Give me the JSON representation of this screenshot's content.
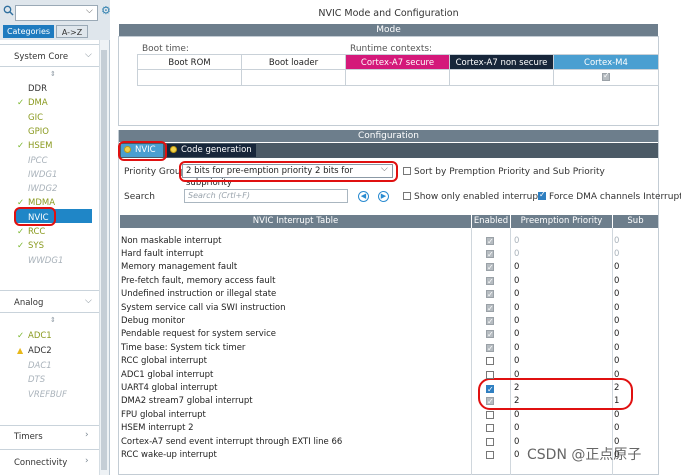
{
  "left_panel": {
    "categories_tab": "Categories",
    "az_tab": "A->Z",
    "system_core": "System Core",
    "system_core_items": [
      {
        "label": "DDR",
        "check": false,
        "style": "n"
      },
      {
        "label": "DMA",
        "check": true,
        "style": "g"
      },
      {
        "label": "GIC",
        "check": false,
        "style": "g"
      },
      {
        "label": "GPIO",
        "check": false,
        "style": "g"
      },
      {
        "label": "HSEM",
        "check": true,
        "style": "g"
      },
      {
        "label": "IPCC",
        "check": false,
        "style": "d"
      },
      {
        "label": "IWDG1",
        "check": false,
        "style": "d"
      },
      {
        "label": "IWDG2",
        "check": false,
        "style": "d"
      },
      {
        "label": "MDMA",
        "check": true,
        "style": "g"
      },
      {
        "label": "NVIC",
        "check": false,
        "style": "sel"
      },
      {
        "label": "RCC",
        "check": true,
        "style": "g"
      },
      {
        "label": "SYS",
        "check": true,
        "style": "g"
      },
      {
        "label": "WWDG1",
        "check": false,
        "style": "d"
      }
    ],
    "analog": "Analog",
    "analog_items": [
      {
        "label": "ADC1",
        "mark": "check",
        "style": "g"
      },
      {
        "label": "ADC2",
        "mark": "warn",
        "style": "n"
      },
      {
        "label": "DAC1",
        "mark": "",
        "style": "d"
      },
      {
        "label": "DTS",
        "mark": "",
        "style": "d"
      },
      {
        "label": "VREFBUF",
        "mark": "",
        "style": "d"
      }
    ],
    "timers": "Timers",
    "connectivity": "Connectivity"
  },
  "title": "NVIC Mode and Configuration",
  "mode": {
    "header": "Mode",
    "boot_time": "Boot time:",
    "runtime_contexts": "Runtime contexts:",
    "boot_rom": "Boot ROM",
    "boot_loader": "Boot loader",
    "ctx_a7_secure": "Cortex-A7 secure",
    "ctx_a7_nonsecure": "Cortex-A7 non secure",
    "ctx_m4": "Cortex-M4"
  },
  "configuration": {
    "header": "Configuration",
    "tab_nvic": "NVIC",
    "tab_codegen": "Code generation",
    "priority_group_label": "Priority Group",
    "priority_group_value": "2 bits for pre-emption priority 2 bits for subpriority",
    "sort_label": "Sort by Premption Priority and Sub Priority",
    "search_label": "Search",
    "search_placeholder": "Search (Crtl+F)",
    "show_enabled_label": "Show only enabled interrupts",
    "force_dma_label": "Force DMA channels Interrupts",
    "colors": {
      "nvic_tab": "#4a9fd1",
      "codegen_tab": "#17263a",
      "secure": "#d4197a",
      "nonsecure": "#17263a",
      "m4": "#4a9fd1"
    }
  },
  "table": {
    "headers": [
      "NVIC Interrupt Table",
      "Enabled",
      "Preemption Priority",
      "Sub Priority"
    ],
    "rows": [
      {
        "name": "Non maskable interrupt",
        "enabled": "fixed",
        "pp": "0",
        "sp": "0",
        "pg": true
      },
      {
        "name": "Hard fault interrupt",
        "enabled": "fixed",
        "pp": "0",
        "sp": "0",
        "pg": true
      },
      {
        "name": "Memory management fault",
        "enabled": "fixed",
        "pp": "0",
        "sp": "0",
        "pg": false
      },
      {
        "name": "Pre-fetch fault, memory access fault",
        "enabled": "fixed",
        "pp": "0",
        "sp": "0",
        "pg": false
      },
      {
        "name": "Undefined instruction or illegal state",
        "enabled": "fixed",
        "pp": "0",
        "sp": "0",
        "pg": false
      },
      {
        "name": "System service call via SWI instruction",
        "enabled": "fixed",
        "pp": "0",
        "sp": "0",
        "pg": false
      },
      {
        "name": "Debug monitor",
        "enabled": "fixed",
        "pp": "0",
        "sp": "0",
        "pg": false
      },
      {
        "name": "Pendable request for system service",
        "enabled": "fixed",
        "pp": "0",
        "sp": "0",
        "pg": false
      },
      {
        "name": "Time base: System tick timer",
        "enabled": "fixed",
        "pp": "0",
        "sp": "0",
        "pg": false
      },
      {
        "name": "RCC global interrupt",
        "enabled": "off",
        "pp": "0",
        "sp": "0",
        "pg": false
      },
      {
        "name": "ADC1 global interrupt",
        "enabled": "off",
        "pp": "0",
        "sp": "0",
        "pg": false
      },
      {
        "name": "UART4 global interrupt",
        "enabled": "on",
        "pp": "2",
        "sp": "2",
        "pg": false
      },
      {
        "name": "DMA2 stream7 global interrupt",
        "enabled": "fixed",
        "pp": "2",
        "sp": "1",
        "pg": false
      },
      {
        "name": "FPU global interrupt",
        "enabled": "off",
        "pp": "0",
        "sp": "0",
        "pg": false
      },
      {
        "name": "HSEM interrupt 2",
        "enabled": "off",
        "pp": "0",
        "sp": "0",
        "pg": false
      },
      {
        "name": "Cortex-A7 send event interrupt through EXTI line 66",
        "enabled": "off",
        "pp": "0",
        "sp": "0",
        "pg": false
      },
      {
        "name": "RCC wake-up interrupt",
        "enabled": "off",
        "pp": "0",
        "sp": "0",
        "pg": false
      }
    ]
  },
  "watermark": "CSDN @正点原子"
}
